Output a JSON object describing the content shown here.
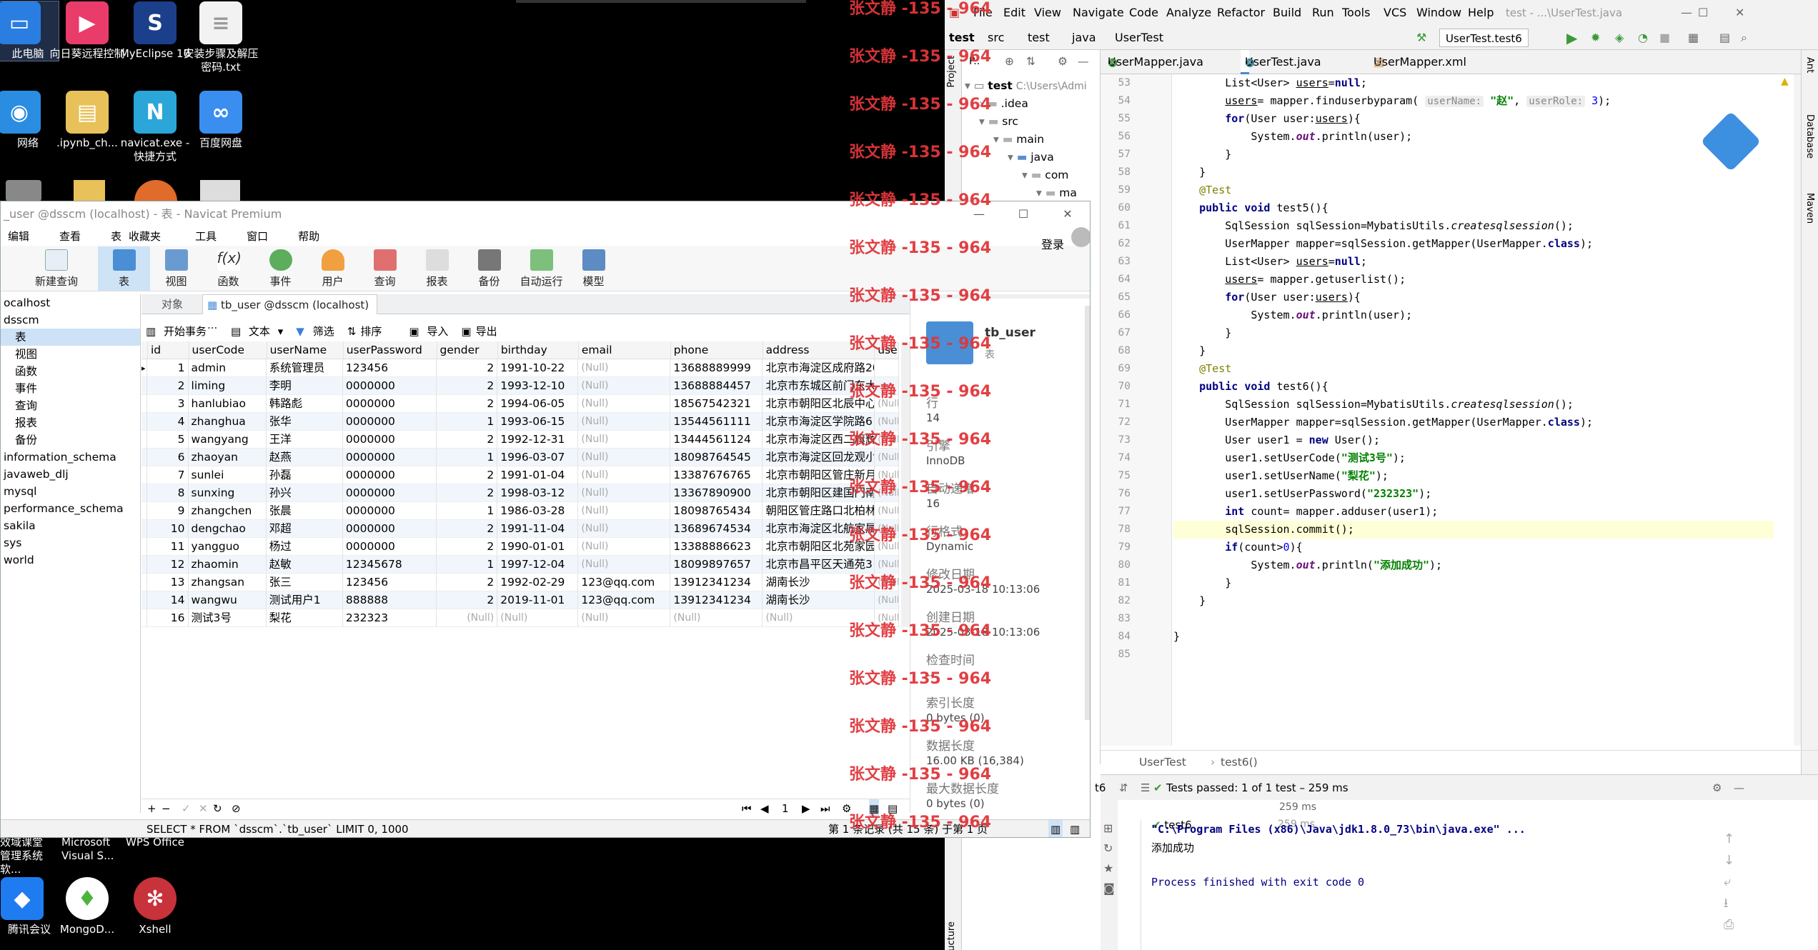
{
  "watermark": "张文静 -135 - 964",
  "desktop": {
    "icons": [
      {
        "label": "此电脑",
        "icon": "computer-icon",
        "color": "#2a7de1"
      },
      {
        "label": "向日葵远程控制",
        "icon": "sunflower-icon",
        "color": "#e93c6b"
      },
      {
        "label": "MyEclipse 10",
        "icon": "myeclipse-icon",
        "color": "#1c3f8c"
      },
      {
        "label": "安装步骤及解压密码.txt",
        "icon": "text-file-icon",
        "color": "#f2f2f2"
      },
      {
        "label": "网络",
        "icon": "network-icon",
        "color": "#2a8de1"
      },
      {
        "label": ".ipynb_ch...",
        "icon": "folder-icon",
        "color": "#e8c15a"
      },
      {
        "label": "navicat.exe - 快捷方式",
        "icon": "navicat-icon",
        "color": "#2aa6d8"
      },
      {
        "label": "百度网盘",
        "icon": "baidu-netdisk-icon",
        "color": "#3a8ef0"
      },
      {
        "label": "腾讯会议",
        "icon": "tencent-meeting-icon",
        "color": "#1f7cf0"
      },
      {
        "label": "MongoD...",
        "icon": "mongodb-icon",
        "color": "#4db33d"
      },
      {
        "label": "Xshell",
        "icon": "xshell-icon",
        "color": "#c8323a"
      }
    ],
    "partial_labels": [
      "效域课堂管理系统软...",
      "Microsoft Visual S...",
      "WPS Office"
    ]
  },
  "navicat": {
    "title": "_user @dsscm (localhost) - 表 - Navicat Premium",
    "login": "登录",
    "menu": [
      "编辑",
      "查看",
      "表",
      "收藏夹",
      "工具",
      "窗口",
      "帮助"
    ],
    "toolbar": [
      {
        "label": "新建查询",
        "icon": "new-query-icon"
      },
      {
        "label": "表",
        "icon": "table-icon",
        "active": true
      },
      {
        "label": "视图",
        "icon": "view-icon"
      },
      {
        "label": "函数",
        "icon": "function-icon"
      },
      {
        "label": "事件",
        "icon": "event-icon"
      },
      {
        "label": "用户",
        "icon": "user-icon"
      },
      {
        "label": "查询",
        "icon": "query-icon"
      },
      {
        "label": "报表",
        "icon": "report-icon"
      },
      {
        "label": "备份",
        "icon": "backup-icon"
      },
      {
        "label": "自动运行",
        "icon": "autorun-icon"
      },
      {
        "label": "模型",
        "icon": "model-icon"
      }
    ],
    "tree": [
      "ocalhost",
      "dsscm",
      "表",
      "视图",
      "函数",
      "事件",
      "查询",
      "报表",
      "备份",
      "information_schema",
      "javaweb_dlj",
      "mysql",
      "performance_schema",
      "sakila",
      "sys",
      "world"
    ],
    "tabs": {
      "objects": "对象",
      "current": "tb_user @dsscm (localhost) ..."
    },
    "data_toolbar": [
      "开始事务",
      "文本",
      "筛选",
      "排序",
      "导入",
      "导出"
    ],
    "columns": [
      "id",
      "userCode",
      "userName",
      "userPassword",
      "gender",
      "birthday",
      "email",
      "phone",
      "address",
      "user"
    ],
    "rows": [
      [
        "1",
        "admin",
        "系统管理员",
        "123456",
        "2",
        "1991-10-22",
        "(Null)",
        "13688889999",
        "北京市海淀区成府路20"
      ],
      [
        "2",
        "liming",
        "李明",
        "0000000",
        "2",
        "1993-12-10",
        "(Null)",
        "13688884457",
        "北京市东城区前门东大"
      ],
      [
        "3",
        "hanlubiao",
        "韩路彪",
        "0000000",
        "2",
        "1994-06-05",
        "(Null)",
        "18567542321",
        "北京市朝阳区北辰中心"
      ],
      [
        "4",
        "zhanghua",
        "张华",
        "0000000",
        "1",
        "1993-06-15",
        "(Null)",
        "13544561111",
        "北京市海淀区学院路6"
      ],
      [
        "5",
        "wangyang",
        "王洋",
        "0000000",
        "2",
        "1992-12-31",
        "(Null)",
        "13444561124",
        "北京市海淀区西二旗辉"
      ],
      [
        "6",
        "zhaoyan",
        "赵燕",
        "0000000",
        "1",
        "1996-03-07",
        "(Null)",
        "18098764545",
        "北京市海淀区回龙观小"
      ],
      [
        "7",
        "sunlei",
        "孙磊",
        "0000000",
        "2",
        "1991-01-04",
        "(Null)",
        "13387676765",
        "北京市朝阳区管庄新月"
      ],
      [
        "8",
        "sunxing",
        "孙兴",
        "0000000",
        "2",
        "1998-03-12",
        "(Null)",
        "13367890900",
        "北京市朝阳区建国门南"
      ],
      [
        "9",
        "zhangchen",
        "张晨",
        "0000000",
        "1",
        "1986-03-28",
        "(Null)",
        "18098765434",
        "朝阳区管庄路口北柏林"
      ],
      [
        "10",
        "dengchao",
        "邓超",
        "0000000",
        "2",
        "1991-11-04",
        "(Null)",
        "13689674534",
        "北京市海淀区北航家属"
      ],
      [
        "11",
        "yangguo",
        "杨过",
        "0000000",
        "2",
        "1990-01-01",
        "(Null)",
        "13388886623",
        "北京市朝阳区北苑家园"
      ],
      [
        "12",
        "zhaomin",
        "赵敏",
        "12345678",
        "1",
        "1997-12-04",
        "(Null)",
        "18099897657",
        "北京市昌平区天通苑3"
      ],
      [
        "13",
        "zhangsan",
        "张三",
        "123456",
        "2",
        "1992-02-29",
        "123@qq.com",
        "13912341234",
        "湖南长沙"
      ],
      [
        "14",
        "wangwu",
        "测试用户1",
        "888888",
        "2",
        "2019-11-01",
        "123@qq.com",
        "13912341234",
        "湖南长沙"
      ],
      [
        "16",
        "测试3号",
        "梨花",
        "232323",
        "(Null)",
        "(Null)",
        "(Null)",
        "(Null)",
        "(Null)"
      ]
    ],
    "info": {
      "table_name": "tb_user",
      "type": "表",
      "props": [
        {
          "k": "行",
          "v": "14"
        },
        {
          "k": "引擎",
          "v": "InnoDB"
        },
        {
          "k": "自动递增",
          "v": "16"
        },
        {
          "k": "行格式",
          "v": "Dynamic"
        },
        {
          "k": "修改日期",
          "v": "2025-03-18 10:13:06"
        },
        {
          "k": "创建日期",
          "v": "2025-03-18 10:13:06"
        },
        {
          "k": "检查时间",
          "v": "--"
        },
        {
          "k": "索引长度",
          "v": "0 bytes (0)"
        },
        {
          "k": "数据长度",
          "v": "16.00 KB (16,384)"
        },
        {
          "k": "最大数据长度",
          "v": "0 bytes (0)"
        }
      ]
    },
    "page": "1",
    "sql": "SELECT * FROM `dsscm`.`tb_user` LIMIT 0, 1000",
    "record_status": "第 1 条记录 (共 15 条) 于第 1 页"
  },
  "ide": {
    "menu": [
      "File",
      "Edit",
      "View",
      "Navigate",
      "Code",
      "Analyze",
      "Refactor",
      "Build",
      "Run",
      "Tools",
      "VCS",
      "Window",
      "Help"
    ],
    "title": "test - ...\\UserTest.java",
    "breadcrumb": [
      "test",
      "src",
      "test",
      "java",
      "UserTest"
    ],
    "run_config": "UserTest.test6",
    "project_label": "P..",
    "project_tree": [
      {
        "t": "test",
        "extra": "C:\\Users\\Admi",
        "lvl": 0
      },
      {
        "t": ".idea",
        "lvl": 1
      },
      {
        "t": "src",
        "lvl": 1
      },
      {
        "t": "main",
        "lvl": 2
      },
      {
        "t": "java",
        "lvl": 3
      },
      {
        "t": "com",
        "lvl": 4
      },
      {
        "t": "ma",
        "lvl": 5
      }
    ],
    "tabs": [
      "UserMapper.java",
      "UserTest.java",
      "UserMapper.xml"
    ],
    "lines": [
      53,
      54,
      55,
      56,
      57,
      58,
      59,
      60,
      61,
      62,
      63,
      64,
      65,
      66,
      67,
      68,
      69,
      70,
      71,
      72,
      73,
      74,
      75,
      76,
      77,
      78,
      79,
      80,
      81,
      82,
      83,
      84,
      85
    ],
    "hint_username": "userName:",
    "hint_userrole": "userRole:",
    "editor_breadcrumb": [
      "UserTest",
      "test6()"
    ],
    "run_tab": "t6",
    "tests_passed": "Tests passed: 1 of 1 test – 259 ms",
    "test_name": "test6",
    "test_time": "259 ms",
    "console": [
      "\"C:\\Program Files (x86)\\Java\\jdk1.8.0_73\\bin\\java.exe\" ...",
      "添加成功",
      "",
      "Process finished with exit code 0"
    ],
    "right_tools": [
      "Ant",
      "Database",
      "Maven"
    ],
    "left_tools": [
      "Project",
      "Structure"
    ]
  }
}
